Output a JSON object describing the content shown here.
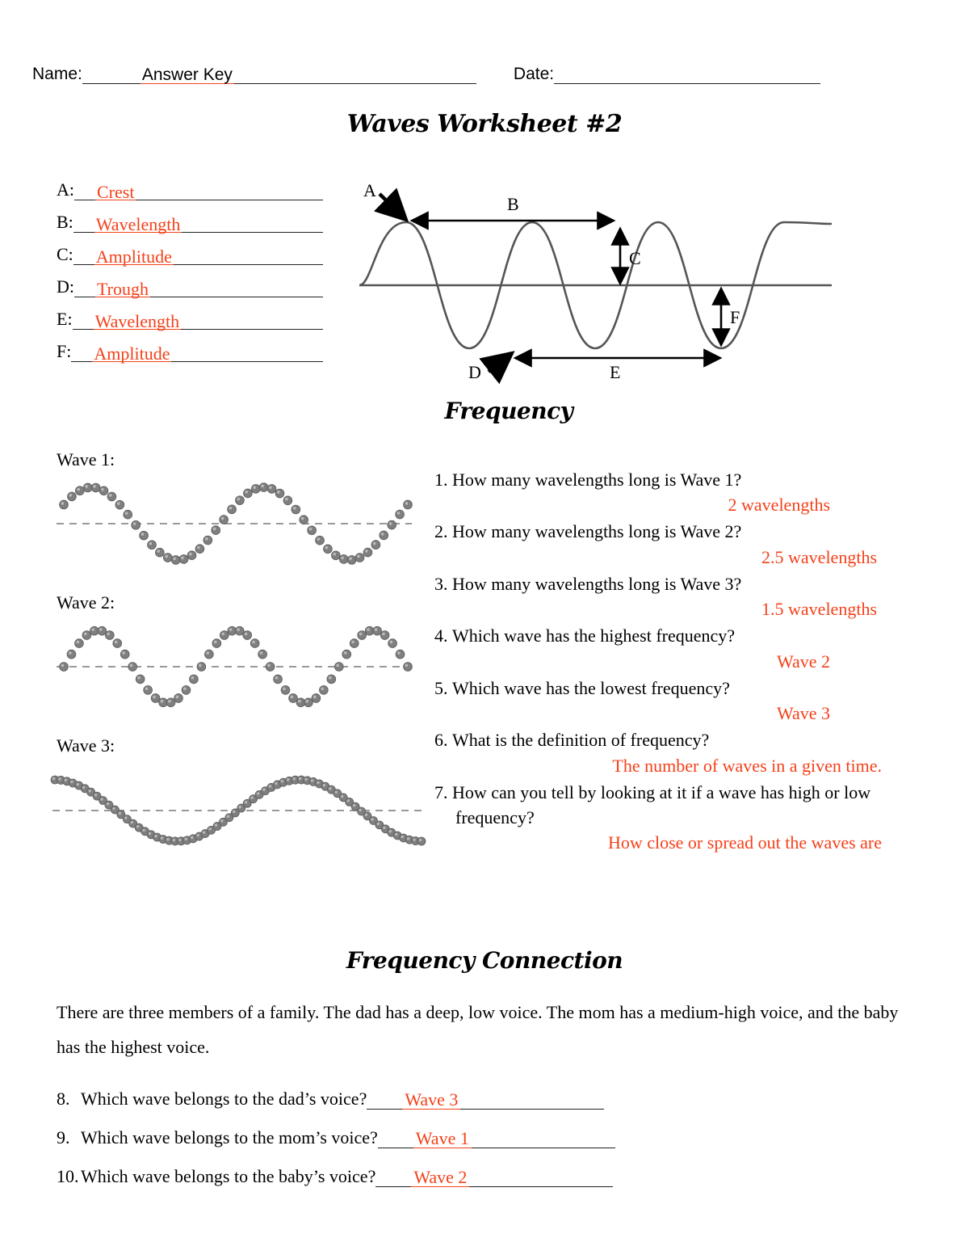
{
  "header": {
    "name_label": "Name:",
    "name_answer": "Answer Key",
    "date_label": "Date:",
    "date_answer": ""
  },
  "title": "Waves Worksheet #2",
  "headings": {
    "frequency": "Frequency",
    "frequency_connection": "Frequency Connection"
  },
  "colors": {
    "answer_red": "#f4411a",
    "wave_line": "#555555",
    "dot_gray": "#808080",
    "dashed_midline": "#999999"
  },
  "label_list": [
    {
      "letter": "A:",
      "answer": "Crest"
    },
    {
      "letter": "B:",
      "answer": "Wavelength"
    },
    {
      "letter": "C:",
      "answer": "Amplitude"
    },
    {
      "letter": "D:",
      "answer": "Trough"
    },
    {
      "letter": "E:",
      "answer": "Wavelength"
    },
    {
      "letter": "F:",
      "answer": "Amplitude"
    }
  ],
  "diagram": {
    "labels": [
      "A",
      "B",
      "C",
      "D",
      "E",
      "F"
    ],
    "description": "sine wave with midline; A points to crest, B spans crest to crest, C amplitude up, D points to trough, E spans trough to trough, F amplitude down"
  },
  "wave_labels": {
    "wave1": "Wave 1:",
    "wave2": "Wave 2:",
    "wave3": "Wave 3:"
  },
  "chart_data": [
    {
      "type": "line",
      "title": "Wave 1",
      "style": "dotted-sine",
      "wavelengths": 2,
      "amplitude": 45,
      "dot_count": 44,
      "midline": true,
      "xlabel": "",
      "ylabel": "",
      "x": [
        0,
        0.25,
        0.5,
        0.75,
        1,
        1.25,
        1.5,
        1.75,
        2
      ],
      "values": [
        0,
        1,
        0,
        -1,
        0,
        1,
        0,
        -1,
        0
      ]
    },
    {
      "type": "line",
      "title": "Wave 2",
      "style": "dotted-sine",
      "wavelengths": 2.5,
      "amplitude": 45,
      "dot_count": 46,
      "midline": true,
      "xlabel": "",
      "ylabel": "",
      "x": [
        0,
        0.25,
        0.5,
        0.75,
        1,
        1.25,
        1.5,
        1.75,
        2,
        2.25,
        2.5
      ],
      "values": [
        0,
        1,
        0,
        -1,
        0,
        1,
        0,
        -1,
        0,
        1,
        0
      ]
    },
    {
      "type": "line",
      "title": "Wave 3",
      "style": "dotted-sine",
      "wavelengths": 1.5,
      "amplitude": 38,
      "dot_count": 62,
      "midline": true,
      "xlabel": "",
      "ylabel": "",
      "x": [
        0,
        0.25,
        0.5,
        0.75,
        1,
        1.25,
        1.5
      ],
      "values": [
        1,
        0,
        -1,
        0,
        1,
        0,
        -1
      ]
    }
  ],
  "questions": [
    {
      "num": "1.",
      "text": "How many wavelengths long is Wave 1?",
      "answer": "2 wavelengths"
    },
    {
      "num": "2.",
      "text": "How many wavelengths long is Wave 2?",
      "answer": "2.5 wavelengths"
    },
    {
      "num": "3.",
      "text": "How many wavelengths long is Wave 3?",
      "answer": "1.5 wavelengths"
    },
    {
      "num": "4.",
      "text": "Which wave has the highest frequency?",
      "answer": "Wave 2"
    },
    {
      "num": "5.",
      "text": "Which wave has the lowest frequency?",
      "answer": "Wave 3"
    },
    {
      "num": "6.",
      "text": "What is the definition of frequency?",
      "answer": "The number of waves in a given time."
    },
    {
      "num": "7.",
      "text": "How can you tell by looking at it if a wave has high or low",
      "text2": "frequency?",
      "answer": "How close or spread out the waves are"
    }
  ],
  "connection_paragraph": "There are three members of a family.  The dad has a deep, low voice.  The mom has a medium-high voice, and the baby has the highest voice.",
  "bottom_questions": [
    {
      "num": "8.",
      "text": "Which wave belongs to the dad’s voice?",
      "answer": "Wave 3"
    },
    {
      "num": "9.",
      "text": "Which wave belongs to the mom’s voice?",
      "answer": "Wave 1"
    },
    {
      "num": "10.",
      "text": "Which wave belongs to the baby’s voice?",
      "answer": "Wave 2"
    }
  ]
}
